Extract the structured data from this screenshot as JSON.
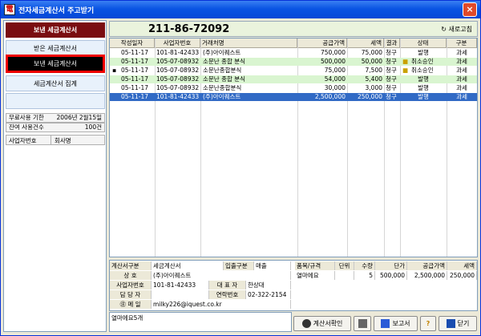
{
  "window": {
    "title": "전자세금계산서 주고받기",
    "app_icon": "電",
    "close": "×"
  },
  "left": {
    "header": "보낸 세금계산서",
    "nav": {
      "received": "받은 세금계산서",
      "sent": "보낸 세금계산서",
      "summary": "세금계산서 집계"
    },
    "free_label": "무료사용 기한",
    "free_value": "2006년 2월15일",
    "remain_label": "잔여 사용건수",
    "remain_value": "100건",
    "col_biz": "사업자번호",
    "col_company": "회사명"
  },
  "bizbar": {
    "biz_no": "211-86-72092",
    "refresh": "새로고침"
  },
  "grid": {
    "headers": [
      "작성일자",
      "사업자번호",
      "거래처명",
      "공급가액",
      "세액",
      "결과",
      "상태",
      "구분"
    ],
    "rows": [
      [
        "05-11-17",
        "101-81-42433",
        "(주)아이퀘스트",
        "750,000",
        "75,000",
        "청구",
        "발행",
        "과세"
      ],
      [
        "05-11-17",
        "105-07-08932",
        "소문난 종합 분식",
        "500,000",
        "50,000",
        "청구",
        "취소승인",
        "과세"
      ],
      [
        "05-11-17",
        "105-07-08932",
        "소문난종합분식",
        "75,000",
        "7,500",
        "청구",
        "취소승인",
        "과세"
      ],
      [
        "05-11-17",
        "105-07-08932",
        "소문난 종합 분식",
        "54,000",
        "5,400",
        "청구",
        "발행",
        "과세"
      ],
      [
        "05-11-17",
        "105-07-08932",
        "소문난종합분식",
        "30,000",
        "3,000",
        "청구",
        "발행",
        "과세"
      ],
      [
        "05-11-17",
        "101-81-42433",
        "(주)아이퀘스트",
        "2,500,000",
        "250,000",
        "청구",
        "발행",
        "과세"
      ]
    ]
  },
  "detail": {
    "type_label": "계산서구분",
    "type_value": "세금계산서",
    "io_label": "입출구분",
    "io_value": "매출",
    "name_label": "상 호",
    "name_value": "(주)아이퀘스트",
    "biz_label": "사업자번호",
    "biz_value": "101-81-42433",
    "ceo_label": "대 표 자",
    "ceo_value": "한상대",
    "mgr_label": "담 당 자",
    "phone_label": "연락번호",
    "phone_value": "02-322-2154",
    "email_label": "㊟ 메 일",
    "email_value": "milky226@iquest.co.kr",
    "item_headers": [
      "품목/규격",
      "단위",
      "수량",
      "단가",
      "공급가액",
      "세액"
    ],
    "item_row": [
      "열마에요",
      "",
      "5",
      "500,000",
      "2,500,000",
      "250,000"
    ],
    "memo": "열마에요5개"
  },
  "buttons": {
    "check": "계산서확인",
    "report": "보고서",
    "help": "?",
    "close": "닫기"
  },
  "colors": {
    "accent": "#7a0d11",
    "selected": "#316ac5",
    "row_green": "#d9f5d0"
  }
}
